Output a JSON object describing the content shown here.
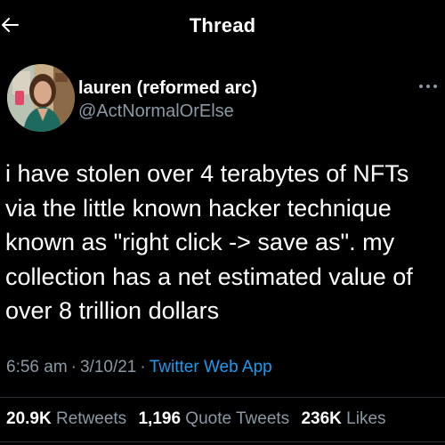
{
  "header": {
    "title": "Thread"
  },
  "author": {
    "display_name": "lauren (reformed arc)",
    "handle": "@ActNormalOrElse"
  },
  "tweet": {
    "text": "i have stolen over 4 terabytes of NFTs via the little known hacker technique known as \"right click -> save as\". my collection has a net estimated value of over 8 trillion dollars",
    "time": "6:56 am",
    "separator": "·",
    "date": "3/10/21",
    "source": "Twitter Web App"
  },
  "stats": {
    "retweets_count": "20.9K",
    "retweets_label": "Retweets",
    "quotes_count": "1,196",
    "quotes_label": "Quote Tweets",
    "likes_count": "236K",
    "likes_label": "Likes"
  },
  "colors": {
    "background": "#000000",
    "text": "#ffffff",
    "secondary_text": "#8b98a5",
    "link": "#1d9bf0"
  },
  "icons": {
    "back": "arrow-left-icon",
    "more": "more-horizontal-icon"
  }
}
